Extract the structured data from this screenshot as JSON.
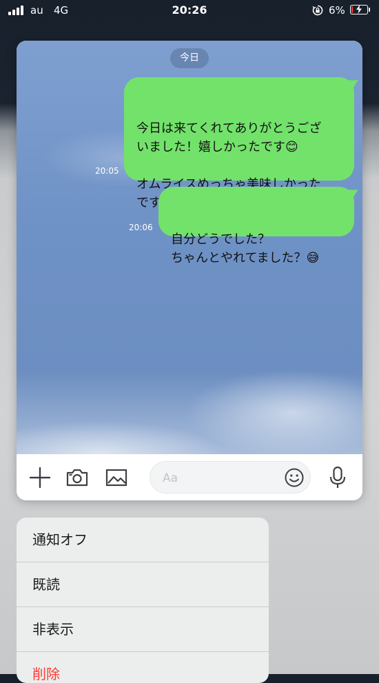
{
  "status_bar": {
    "carrier": "au",
    "network": "4G",
    "time": "20:26",
    "battery": "6%",
    "battery_level": 0.06
  },
  "chat": {
    "date_label": "今日",
    "messages": [
      {
        "text": "今日は来てくれてありがとうござ\nいました！嬉しかったです😊\n\nオムライスめっちゃ美味しかった\nですね☺️",
        "time": "20:05"
      },
      {
        "text": "自分どうでした？\nちゃんとやれてました？😅",
        "time": "20:06"
      }
    ],
    "bubble_color": "#72e26b"
  },
  "input_bar": {
    "placeholder": "Aa",
    "icons": [
      "plus-icon",
      "camera-icon",
      "image-icon",
      "emoji-icon",
      "microphone-icon"
    ]
  },
  "menu": {
    "items": [
      {
        "label": "通知オフ"
      },
      {
        "label": "既読"
      },
      {
        "label": "非表示"
      },
      {
        "label": "削除"
      }
    ],
    "danger_color": "#ff3b30"
  }
}
